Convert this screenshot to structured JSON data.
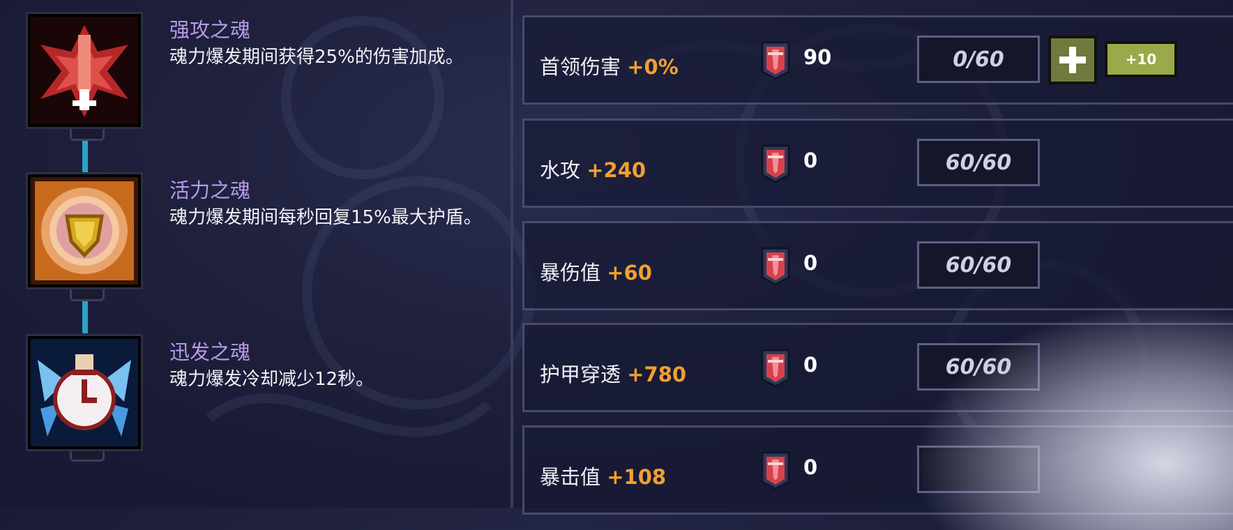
{
  "souls": [
    {
      "title": "强攻之魂",
      "desc": "魂力爆发期间获得25%的伤害加成。",
      "icon": "red-flame-soul-icon",
      "color": "#c83a3a"
    },
    {
      "title": "活力之魂",
      "desc": "魂力爆发期间每秒回复15%最大护盾。",
      "icon": "golden-shield-soul-icon",
      "color": "#e89a3a"
    },
    {
      "title": "迅发之魂",
      "desc": "魂力爆发冷却减少12秒。",
      "icon": "blue-clock-soul-icon",
      "color": "#3a8ae8"
    }
  ],
  "stats": [
    {
      "label": "首领伤害",
      "bonus": "+0%",
      "gems": "90",
      "progress": "0/60",
      "plus_label": "+",
      "plus10_label": "+10"
    },
    {
      "label": "水攻",
      "bonus": "+240",
      "gems": "0",
      "progress": "60/60"
    },
    {
      "label": "暴伤值",
      "bonus": "+60",
      "gems": "0",
      "progress": "60/60"
    },
    {
      "label": "护甲穿透",
      "bonus": "+780",
      "gems": "0",
      "progress": "60/60"
    },
    {
      "label": "暴击值",
      "bonus": "+108",
      "gems": "0",
      "progress": ""
    }
  ],
  "colors": {
    "bonus": "#f0a030",
    "soul_title": "#b79ae8",
    "connector": "#2aa3c9",
    "button": "#9aa94a"
  }
}
